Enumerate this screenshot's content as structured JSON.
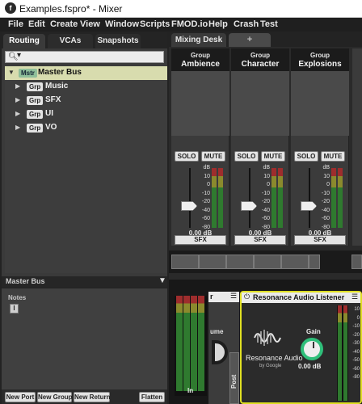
{
  "window": {
    "title": "Examples.fspro* - Mixer",
    "app_icon": "fmod-logo-icon"
  },
  "menubar": [
    "File",
    "Edit",
    "Create",
    "View",
    "Window",
    "Scripts",
    "FMOD.io",
    "Help",
    "Crash",
    "Test"
  ],
  "left_tabs": [
    "Routing",
    "VCAs",
    "Snapshots"
  ],
  "tree": [
    {
      "badge": "Mstr",
      "label": "Master Bus",
      "selected": true
    },
    {
      "badge": "Grp",
      "label": "Music"
    },
    {
      "badge": "Grp",
      "label": "SFX"
    },
    {
      "badge": "Grp",
      "label": "UI"
    },
    {
      "badge": "Grp",
      "label": "VO"
    }
  ],
  "inspector": {
    "title": "Master Bus",
    "notes_label": "Notes",
    "cursor_glyph": "I"
  },
  "bottom_buttons": [
    "New Port",
    "New Group",
    "New Return",
    "Flatten"
  ],
  "right_tabs": {
    "active": "Mixing Desk",
    "add": "+"
  },
  "strips": [
    {
      "type": "Group",
      "name": "Ambience",
      "solo": "SOLO",
      "mute": "MUTE",
      "volume": "0.00 dB",
      "route": "SFX"
    },
    {
      "type": "Group",
      "name": "Character",
      "solo": "SOLO",
      "mute": "MUTE",
      "volume": "0.00 dB",
      "route": "SFX"
    },
    {
      "type": "Group",
      "name": "Explosions",
      "solo": "SOLO",
      "mute": "MUTE",
      "volume": "0.00 dB",
      "route": "SFX"
    }
  ],
  "db_scale": [
    "dB",
    "10",
    "0",
    "-10",
    "-20",
    "-40",
    "-60",
    "-80"
  ],
  "effects": {
    "input_label": "In",
    "prev_title_fragment": "r",
    "prev_label_fragment": "ume",
    "post_label": "Post",
    "resonance": {
      "title": "Resonance Audio Listener",
      "brand": "Resonance Audio",
      "brand_sub": "by Google",
      "gain_label": "Gain",
      "gain_value": "0.00 dB",
      "scale": [
        "10",
        "0",
        "-10",
        "-20",
        "-30",
        "-40",
        "-50",
        "-60",
        "-80"
      ]
    }
  },
  "colors": {
    "selected_row": "#d8dcae",
    "accent_border": "#dede22",
    "gain_ring": "#2fbf7a"
  }
}
